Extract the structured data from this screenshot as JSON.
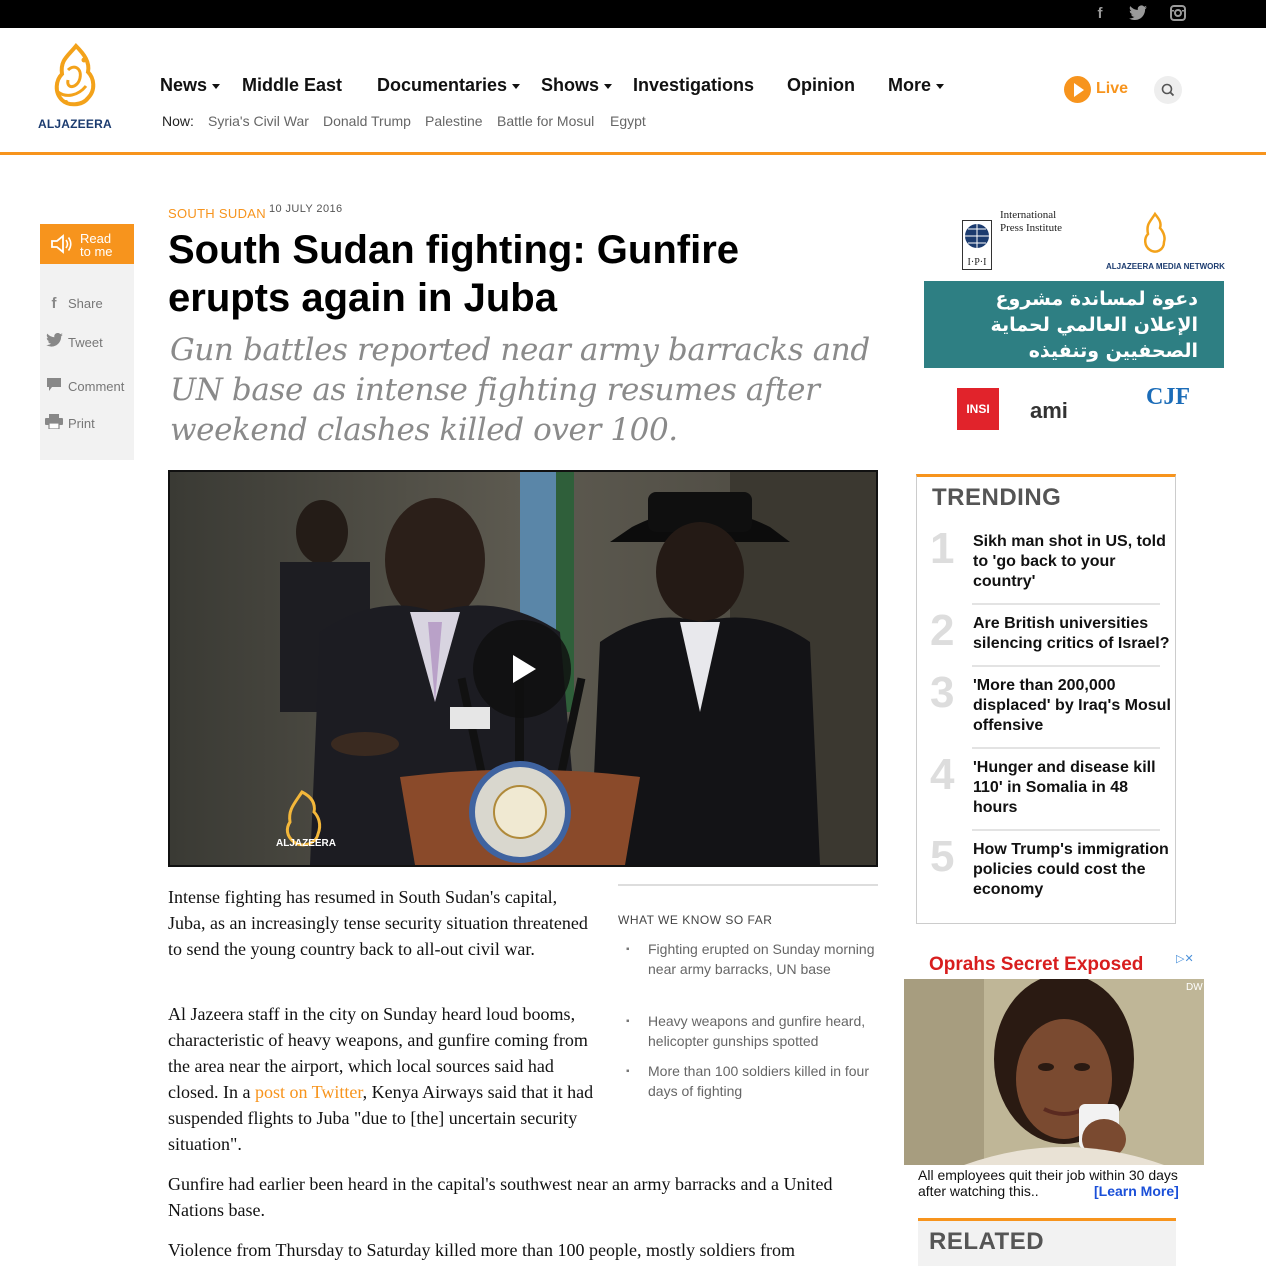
{
  "social": {
    "facebook": "f",
    "twitter": "t",
    "instagram": "◎"
  },
  "header": {
    "logo_text": "ALJAZEERA",
    "nav": [
      {
        "label": "News",
        "dropdown": true
      },
      {
        "label": "Middle East",
        "dropdown": false
      },
      {
        "label": "Documentaries",
        "dropdown": true
      },
      {
        "label": "Shows",
        "dropdown": true
      },
      {
        "label": "Investigations",
        "dropdown": false
      },
      {
        "label": "Opinion",
        "dropdown": false
      },
      {
        "label": "More",
        "dropdown": true
      }
    ],
    "now_label": "Now:",
    "now_links": [
      "Syria's Civil War",
      "Donald Trump",
      "Palestine",
      "Battle for Mosul",
      "Egypt"
    ],
    "live_label": "Live"
  },
  "rail": {
    "read_to_me": "Read\nto me",
    "share": "Share",
    "tweet": "Tweet",
    "comment": "Comment",
    "print": "Print"
  },
  "article": {
    "kicker": "SOUTH SUDAN",
    "date": "10 JULY 2016",
    "headline": "South Sudan fighting: Gunfire erupts again in Juba",
    "standfirst": "Gun battles reported near army barracks and UN base as intense fighting resumes after weekend clashes killed over 100.",
    "video_logo": "ALJAZEERA",
    "p1": "Intense fighting has resumed in South Sudan's capital, Juba, as an increasingly tense security situation threatened to send the young country back to all-out civil war.",
    "p2_before": "Al Jazeera staff in the city on Sunday heard loud booms, characteristic of heavy weapons, and gunfire coming from the area near the airport, which local sources said had closed. In a ",
    "p2_link": "post on Twitter",
    "p2_after": ", Kenya Airways said that it had suspended flights to Juba \"due to [the] uncertain security situation\".",
    "p3": "Gunfire had earlier been heard in the capital's southwest near an army barracks and a United Nations base.",
    "p4": "Violence from Thursday to Saturday killed more than 100 people, mostly soldiers from"
  },
  "what_we_know": {
    "title": "WHAT WE KNOW SO FAR",
    "items": [
      "Fighting erupted on Sunday morning near army barracks, UN base",
      "Heavy weapons and gunfire heard, helicopter gunships spotted",
      "More than 100 soldiers killed in four days of fighting"
    ]
  },
  "sponsors": {
    "ipi": "International Press Institute",
    "ipi_mark": "I·P·I",
    "ajmn": "ALJAZEERA MEDIA NETWORK",
    "banner_ar": "دعوة لمساندة مشروع الإعلان العالمي لحماية الصحفيين وتنفيذه",
    "insi": "INSI",
    "ami": "ami",
    "cfj": "CJF"
  },
  "trending": {
    "title": "TRENDING",
    "items": [
      {
        "num": "1",
        "text": "Sikh man shot in US, told to 'go back to your country'"
      },
      {
        "num": "2",
        "text": "Are British universities silencing critics of Israel?"
      },
      {
        "num": "3",
        "text": "'More than 200,000 displaced' by Iraq's Mosul offensive"
      },
      {
        "num": "4",
        "text": "'Hunger and disease kill 110' in Somalia in 48 hours"
      },
      {
        "num": "5",
        "text": "How Trump's immigration policies could cost the economy"
      }
    ]
  },
  "ad": {
    "title": "Oprahs Secret Exposed",
    "dw": "DW",
    "caption": "All employees quit their job within 30 days after watching this..",
    "learn_more": "[Learn More]"
  },
  "related": {
    "title": "RELATED"
  },
  "colors": {
    "brand_orange": "#f7941d",
    "teal": "#2e7f83",
    "ad_red": "#d81e1e"
  }
}
